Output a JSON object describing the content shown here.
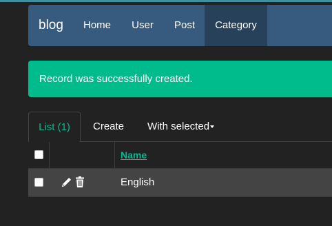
{
  "navbar": {
    "brand": "blog",
    "items": [
      {
        "label": "Home"
      },
      {
        "label": "User"
      },
      {
        "label": "Post"
      },
      {
        "label": "Category",
        "active": true
      }
    ]
  },
  "alert": {
    "message": "Record was successfully created."
  },
  "tabs": {
    "list": "List (1)",
    "create": "Create",
    "with_selected": "With selected"
  },
  "table": {
    "columns": [
      "",
      "",
      "Name"
    ],
    "rows": [
      {
        "name": "English",
        "actions": [
          "pencil-icon",
          "trash-icon"
        ]
      }
    ]
  },
  "colors": {
    "navbar": "#375a7f",
    "navbar_active": "#28415b",
    "success": "#00bc8c",
    "background": "#222222",
    "row": "#444444"
  }
}
